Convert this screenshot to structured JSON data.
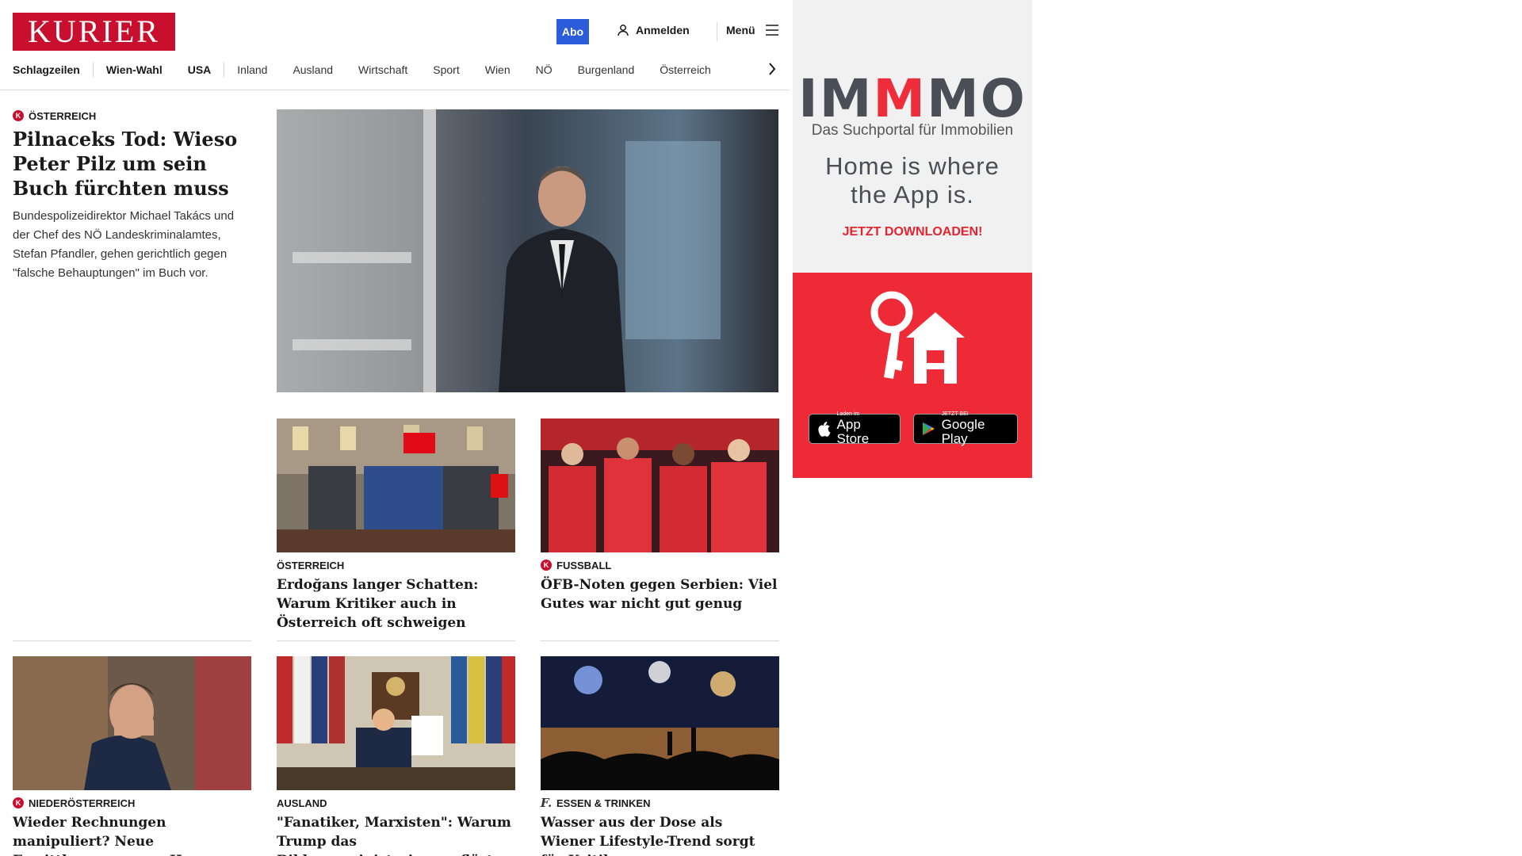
{
  "header": {
    "logo": "KURIER",
    "abo_label": "Abo",
    "login_label": "Anmelden",
    "menu_label": "Menü"
  },
  "nav": {
    "items": [
      "Schlagzeilen",
      "Wien-Wahl",
      "USA",
      "Inland",
      "Ausland",
      "Wirtschaft",
      "Sport",
      "Wien",
      "NÖ",
      "Burgenland",
      "Österreich"
    ]
  },
  "lead": {
    "kicker": "ÖSTERREICH",
    "title": "Pilnaceks Tod: Wieso Peter Pilz um sein Buch fürchten muss",
    "summary": "Bundespolizeidirektor Michael Takács und der Chef des NÖ Landeskriminalamtes, Stefan Pfandler, gehen gerichtlich gegen \"falsche Behauptungen\" im Buch vor."
  },
  "teasers": [
    {
      "kicker": "ÖSTERREICH",
      "title": "Erdoğans langer Schatten: Warum Kritiker auch in Österreich oft schweigen"
    },
    {
      "kicker": "FUSSBALL",
      "title": "ÖFB-Noten gegen Serbien: Viel Gutes war nicht gut genug"
    },
    {
      "kicker": "NIEDERÖSTERREICH",
      "title": "Wieder Rechnungen manipuliert? Neue Ermittlungen gegen Hannes Koza"
    },
    {
      "kicker": "AUSLAND",
      "title": "\"Fanatiker, Marxisten\": Warum Trump das Bildungsministerium auflöst"
    },
    {
      "kicker": "ESSEN & TRINKEN",
      "title": "Wasser aus der Dose als Wiener Lifestyle-Trend sorgt für Kritik"
    }
  ],
  "ad": {
    "brand_a": "IM",
    "brand_b": "M",
    "brand_c": "MO",
    "subtitle": "Das Suchportal für Immobilien",
    "slogan_line1": "Home is where",
    "slogan_line2": "the App is.",
    "cta": "JETZT DOWNLOADEN!",
    "appstore_small": "Laden im",
    "appstore_big": "App Store",
    "googleplay_small": "JETZT BEI",
    "googleplay_big": "Google Play",
    "colors": {
      "brand_red": "#ee2a36",
      "brand_gray": "#4a4f57"
    }
  },
  "colors": {
    "logo_red": "#c8102e",
    "abo_blue": "#2b5cd9"
  }
}
